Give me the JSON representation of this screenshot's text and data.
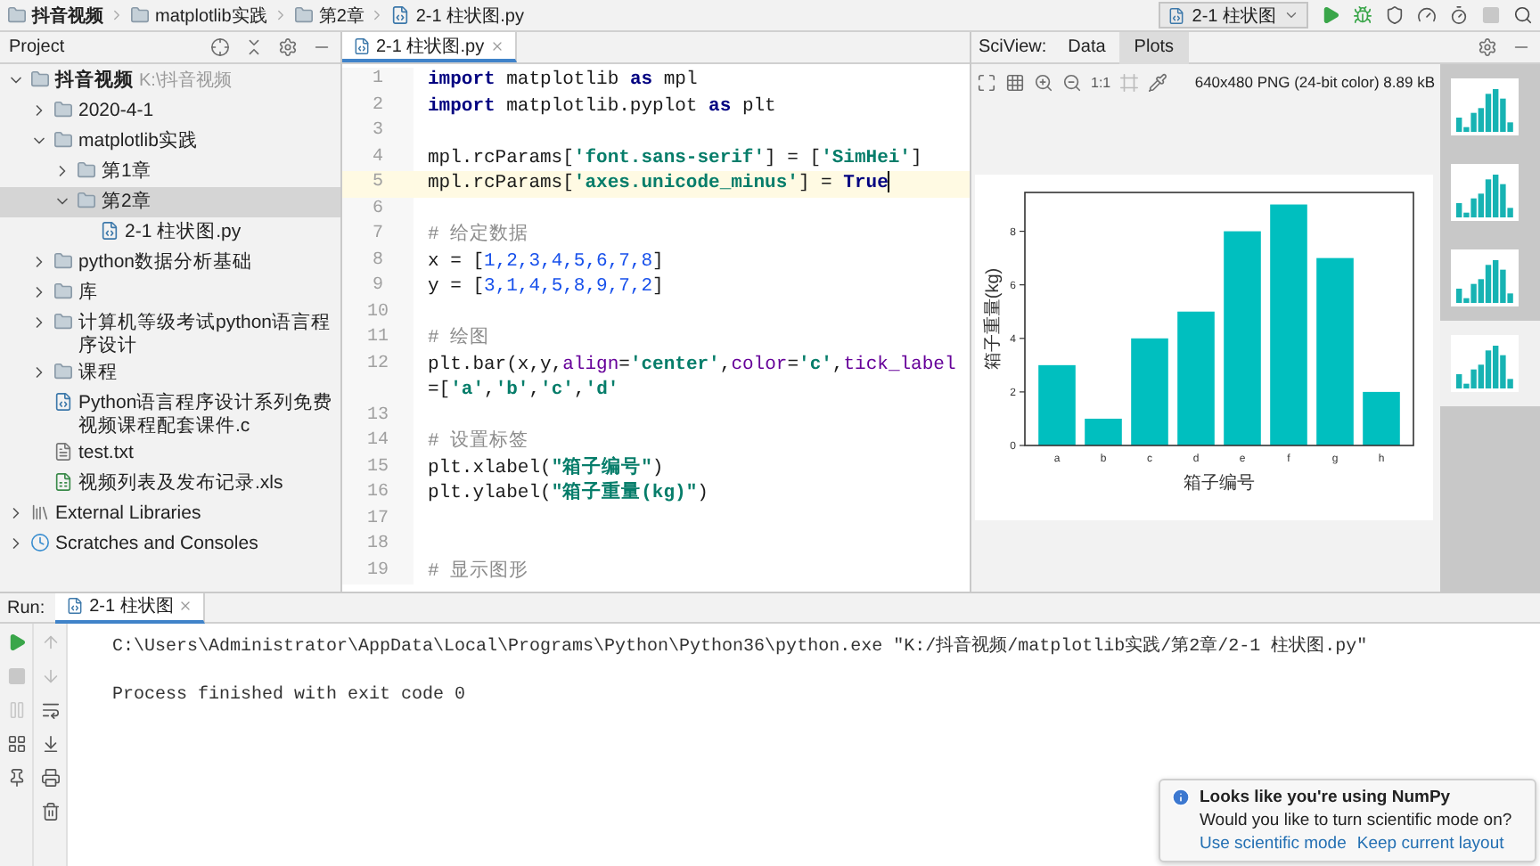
{
  "breadcrumbs": [
    {
      "label": "抖音视频",
      "kind": "folder"
    },
    {
      "label": "matplotlib实践",
      "kind": "folder"
    },
    {
      "label": "第2章",
      "kind": "folder"
    },
    {
      "label": "2-1 柱状图.py",
      "kind": "python-file"
    }
  ],
  "run_config": {
    "label": "2-1 柱状图"
  },
  "project": {
    "title": "Project",
    "tree": [
      {
        "name": "抖音视频",
        "hint": "K:\\抖音视频",
        "kind": "folder",
        "expanded": true,
        "selected": false,
        "children": [
          {
            "name": "2020-4-1",
            "kind": "folder",
            "expanded": false,
            "selected": false
          },
          {
            "name": "matplotlib实践",
            "kind": "folder",
            "expanded": true,
            "selected": false,
            "children": [
              {
                "name": "第1章",
                "kind": "folder",
                "expanded": false,
                "selected": false
              },
              {
                "name": "第2章",
                "kind": "folder",
                "expanded": true,
                "selected": true,
                "children": [
                  {
                    "name": "2-1 柱状图.py",
                    "kind": "python-file",
                    "selected": false
                  }
                ]
              }
            ]
          },
          {
            "name": "python数据分析基础",
            "kind": "folder",
            "expanded": false,
            "selected": false
          },
          {
            "name": "库",
            "kind": "folder",
            "expanded": false,
            "selected": false
          },
          {
            "name": "计算机等级考试python语言程序设计",
            "kind": "folder",
            "expanded": false,
            "selected": false
          },
          {
            "name": "课程",
            "kind": "folder",
            "expanded": false,
            "selected": false
          },
          {
            "name": "Python语言程序设计系列免费视频课程配套课件.c",
            "kind": "python-file",
            "selected": false
          },
          {
            "name": "test.txt",
            "kind": "text-file",
            "selected": false
          },
          {
            "name": "视频列表及发布记录.xls",
            "kind": "spreadsheet",
            "selected": false
          }
        ]
      },
      {
        "name": "External Libraries",
        "kind": "library",
        "expanded": false,
        "selected": false
      },
      {
        "name": "Scratches and Consoles",
        "kind": "scratches",
        "expanded": false,
        "selected": false
      }
    ]
  },
  "editor": {
    "tabs": [
      {
        "label": "2-1 柱状图.py",
        "selected": true
      }
    ],
    "lines": [
      {
        "number": "1",
        "current": false,
        "tokens": [
          {
            "kind": "kw",
            "t": "import"
          },
          {
            "kind": "plain",
            "t": " matplotlib "
          },
          {
            "kind": "kw",
            "t": "as"
          },
          {
            "kind": "plain",
            "t": " mpl"
          }
        ]
      },
      {
        "number": "2",
        "current": false,
        "tokens": [
          {
            "kind": "kw",
            "t": "import"
          },
          {
            "kind": "plain",
            "t": " matplotlib.pyplot "
          },
          {
            "kind": "kw",
            "t": "as"
          },
          {
            "kind": "plain",
            "t": " plt"
          }
        ]
      },
      {
        "number": "3",
        "current": false
      },
      {
        "number": "4",
        "current": false,
        "tokens": [
          {
            "kind": "plain",
            "t": "mpl.rcParams["
          },
          {
            "kind": "str",
            "t": "'font.sans-serif'"
          },
          {
            "kind": "plain",
            "t": "] = ["
          },
          {
            "kind": "str",
            "t": "'SimHei'"
          },
          {
            "kind": "plain",
            "t": "]"
          }
        ]
      },
      {
        "number": "5",
        "current": true,
        "tokens": [
          {
            "kind": "plain",
            "t": "mpl.rcParams["
          },
          {
            "kind": "str",
            "t": "'axes.unicode_minus'"
          },
          {
            "kind": "plain",
            "t": "] = "
          },
          {
            "kind": "kw",
            "t": "True"
          }
        ]
      },
      {
        "number": "6",
        "current": false
      },
      {
        "number": "7",
        "current": false,
        "tokens": [
          {
            "kind": "cmt",
            "t": "# 给定数据"
          }
        ]
      },
      {
        "number": "8",
        "current": false,
        "tokens": [
          {
            "kind": "plain",
            "t": "x = ["
          },
          {
            "kind": "num",
            "t": "1,2,3,4,5,6,7,8"
          },
          {
            "kind": "plain",
            "t": "]"
          }
        ]
      },
      {
        "number": "9",
        "current": false,
        "tokens": [
          {
            "kind": "plain",
            "t": "y = ["
          },
          {
            "kind": "num",
            "t": "3,1,4,5,8,9,7,2"
          },
          {
            "kind": "plain",
            "t": "]"
          }
        ]
      },
      {
        "number": "10",
        "current": false
      },
      {
        "number": "11",
        "current": false,
        "tokens": [
          {
            "kind": "cmt",
            "t": "# 绘图"
          }
        ]
      },
      {
        "number": "12",
        "current": false,
        "tokens": [
          {
            "kind": "plain",
            "t": "plt.bar(x,y,"
          },
          {
            "kind": "param",
            "t": "align"
          },
          {
            "kind": "plain",
            "t": "="
          },
          {
            "kind": "str",
            "t": "'center'"
          },
          {
            "kind": "plain",
            "t": ","
          },
          {
            "kind": "param",
            "t": "color"
          },
          {
            "kind": "plain",
            "t": "="
          },
          {
            "kind": "str",
            "t": "'c'"
          },
          {
            "kind": "plain",
            "t": ","
          },
          {
            "kind": "param",
            "t": "tick_label"
          },
          {
            "kind": "plain",
            "t": "=["
          },
          {
            "kind": "str",
            "t": "'a'"
          },
          {
            "kind": "plain",
            "t": ","
          },
          {
            "kind": "str",
            "t": "'b'"
          },
          {
            "kind": "plain",
            "t": ","
          },
          {
            "kind": "str",
            "t": "'c'"
          },
          {
            "kind": "plain",
            "t": ","
          },
          {
            "kind": "str",
            "t": "'d'"
          }
        ]
      },
      {
        "number": "13",
        "current": false
      },
      {
        "number": "14",
        "current": false,
        "tokens": [
          {
            "kind": "cmt",
            "t": "# 设置标签"
          }
        ]
      },
      {
        "number": "15",
        "current": false,
        "tokens": [
          {
            "kind": "plain",
            "t": "plt.xlabel("
          },
          {
            "kind": "str",
            "t": "\"箱子编号\""
          },
          {
            "kind": "plain",
            "t": ")"
          }
        ]
      },
      {
        "number": "16",
        "current": false,
        "tokens": [
          {
            "kind": "plain",
            "t": "plt.ylabel("
          },
          {
            "kind": "str",
            "t": "\"箱子重量(kg)\""
          },
          {
            "kind": "plain",
            "t": ")"
          }
        ]
      },
      {
        "number": "17",
        "current": false
      },
      {
        "number": "18",
        "current": false
      },
      {
        "number": "19",
        "current": false,
        "tokens": [
          {
            "kind": "cmt",
            "t": "# 显示图形"
          }
        ]
      }
    ]
  },
  "sciview": {
    "label": "SciView:",
    "tabs": [
      {
        "label": "Data",
        "selected": false
      },
      {
        "label": "Plots",
        "selected": true
      }
    ],
    "actual_size": "1:1",
    "image_info": "640x480 PNG (24-bit color) 8.89 kB",
    "chart_data": {
      "type": "bar",
      "xlabel": "箱子编号",
      "ylabel": "箱子重量(kg)",
      "categories": [
        "a",
        "b",
        "c",
        "d",
        "e",
        "f",
        "g",
        "h"
      ],
      "values": [
        3,
        1,
        4,
        5,
        8,
        9,
        7,
        2
      ],
      "ylim": [
        0,
        9.45
      ],
      "yticks": [
        0,
        2,
        4,
        6,
        8
      ]
    },
    "thumbnails": [
      {
        "selected": false
      },
      {
        "selected": false
      },
      {
        "selected": false
      },
      {
        "selected": true
      }
    ]
  },
  "run": {
    "label": "Run:",
    "tabs": [
      {
        "label": "2-1 柱状图",
        "selected": true
      }
    ],
    "output": [
      "C:\\Users\\Administrator\\AppData\\Local\\Programs\\Python\\Python36\\python.exe \"K:/抖音视频/matplotlib实践/第2章/2-1 柱状图.py\"",
      "Process finished with exit code 0"
    ]
  },
  "notification": {
    "title": "Looks like you're using NumPy",
    "body": "Would you like to turn scientific mode on?",
    "links": [
      "Use scientific mode",
      "Keep current layout"
    ]
  }
}
